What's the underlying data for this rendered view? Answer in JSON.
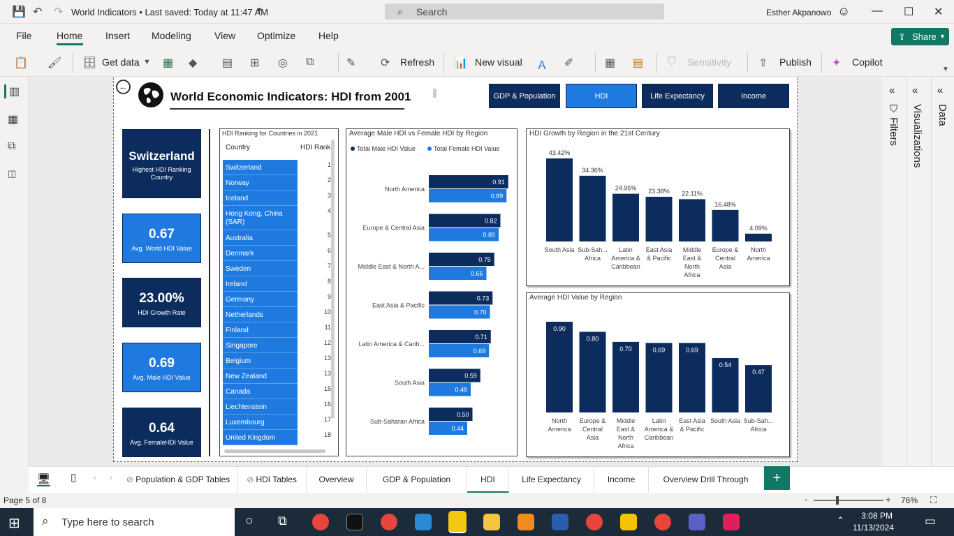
{
  "titlebar": {
    "title": "World Indicators • Last saved: Today at 11:47 AM",
    "search_placeholder": "Search",
    "user": "Esther Akpanowo"
  },
  "menu": {
    "items": [
      "File",
      "Home",
      "Insert",
      "Modeling",
      "View",
      "Optimize",
      "Help"
    ],
    "share": "Share"
  },
  "ribbon": {
    "get_data": "Get data",
    "refresh": "Refresh",
    "new_visual": "New visual",
    "sensitivity": "Sensitivity",
    "publish": "Publish",
    "copilot": "Copilot"
  },
  "side_panes": {
    "filters": "Filters",
    "visualizations": "Visualizations",
    "data": "Data"
  },
  "report": {
    "title": "World Economic Indicators: HDI from 2001",
    "nav": [
      {
        "label": "GDP & Population",
        "active": false
      },
      {
        "label": "HDI",
        "active": true
      },
      {
        "label": "Life Expectancy",
        "active": false
      },
      {
        "label": "Income",
        "active": false
      }
    ],
    "kpis": [
      {
        "value": "Switzerland",
        "label": "Highest HDI Ranking Country",
        "color": "#0d2c5e"
      },
      {
        "value": "0.67",
        "label": "Avg. World HDI Value",
        "color": "#1f7ae0"
      },
      {
        "value": "23.00%",
        "label": "HDI Growth Rate",
        "color": "#0d2c5e"
      },
      {
        "value": "0.69",
        "label": "Avg. Male HDI Value",
        "color": "#1f7ae0"
      },
      {
        "value": "0.64",
        "label": "Avg. FemaleHDI Value",
        "color": "#0d2c5e"
      }
    ],
    "ranking_table": {
      "title": "HDI Ranking for Countries in 2021",
      "col_country": "Country",
      "col_rank": "HDI Rank",
      "rows": [
        {
          "country": "Switzerland",
          "rank": "1"
        },
        {
          "country": "Norway",
          "rank": "2"
        },
        {
          "country": "Iceland",
          "rank": "3"
        },
        {
          "country": "Hong Kong, China (SAR)",
          "rank": "4"
        },
        {
          "country": "Australia",
          "rank": "5"
        },
        {
          "country": "Denmark",
          "rank": "6"
        },
        {
          "country": "Sweden",
          "rank": "7"
        },
        {
          "country": "Ireland",
          "rank": "8"
        },
        {
          "country": "Germany",
          "rank": "9"
        },
        {
          "country": "Netherlands",
          "rank": "10"
        },
        {
          "country": "Finland",
          "rank": "11"
        },
        {
          "country": "Singapore",
          "rank": "12"
        },
        {
          "country": "Belgium",
          "rank": "13"
        },
        {
          "country": "New Zealand",
          "rank": "13"
        },
        {
          "country": "Canada",
          "rank": "15"
        },
        {
          "country": "Liechtenstein",
          "rank": "16"
        },
        {
          "country": "Luxembourg",
          "rank": "17"
        },
        {
          "country": "United Kingdom",
          "rank": "18"
        }
      ]
    }
  },
  "chart_data": [
    {
      "type": "bar",
      "orientation": "horizontal",
      "title": "Average Male HDI vs Female HDI by Region",
      "categories": [
        "North America",
        "Europe & Central Asia",
        "Middle East & North A...",
        "East Asia & Pacific",
        "Latin America & Carib...",
        "South Asia",
        "Sub-Saharan Africa"
      ],
      "series": [
        {
          "name": "Total Male HDI Value",
          "color": "#0d2c5e",
          "values": [
            0.91,
            0.82,
            0.75,
            0.73,
            0.71,
            0.59,
            0.5
          ]
        },
        {
          "name": "Total Female HDI Value",
          "color": "#1f7ae0",
          "values": [
            0.89,
            0.8,
            0.66,
            0.7,
            0.69,
            0.48,
            0.44
          ]
        }
      ],
      "legend": "top-left",
      "xlim": [
        0,
        1
      ]
    },
    {
      "type": "bar",
      "title": "HDI Growth by Region in the 21st Century",
      "categories": [
        "South Asia",
        "Sub-Sah... Africa",
        "Latin America & Caribbean",
        "East Asia & Pacific",
        "Middle East & North Africa",
        "Europe & Central Asia",
        "North America"
      ],
      "values": [
        43.42,
        34.36,
        24.95,
        23.38,
        22.11,
        16.48,
        4.09
      ],
      "labels": [
        "43.42%",
        "34.36%",
        "24.95%",
        "23.38%",
        "22.11%",
        "16.48%",
        "4.09%"
      ],
      "color": "#0d2c5e",
      "ylim": [
        0,
        43.42
      ]
    },
    {
      "type": "bar",
      "title": "Average HDI Value by Region",
      "categories": [
        "North America",
        "Europe & Central Asia",
        "Middle East & North Africa",
        "Latin America & Caribbean",
        "East Asia & Pacific",
        "South Asia",
        "Sub-Sah... Africa"
      ],
      "values": [
        0.9,
        0.8,
        0.7,
        0.69,
        0.69,
        0.54,
        0.47
      ],
      "labels": [
        "0.90",
        "0.80",
        "0.70",
        "0.69",
        "0.69",
        "0.54",
        "0.47"
      ],
      "color": "#0d2c5e",
      "ylim": [
        0,
        0.9
      ]
    }
  ],
  "page_tabs": [
    {
      "label": "Population & GDP Tables",
      "hidden": true
    },
    {
      "label": "HDI Tables",
      "hidden": true
    },
    {
      "label": "Overview",
      "hidden": false
    },
    {
      "label": "GDP & Population",
      "hidden": false
    },
    {
      "label": "HDI",
      "hidden": false,
      "active": true
    },
    {
      "label": "Life Expectancy",
      "hidden": false
    },
    {
      "label": "Income",
      "hidden": false
    },
    {
      "label": "Overview Drill Through",
      "hidden": false
    }
  ],
  "status": {
    "page": "Page 5 of 8",
    "zoom": "76%"
  },
  "taskbar": {
    "search_placeholder": "Type here to search",
    "time": "3:08 PM",
    "date": "11/13/2024"
  }
}
